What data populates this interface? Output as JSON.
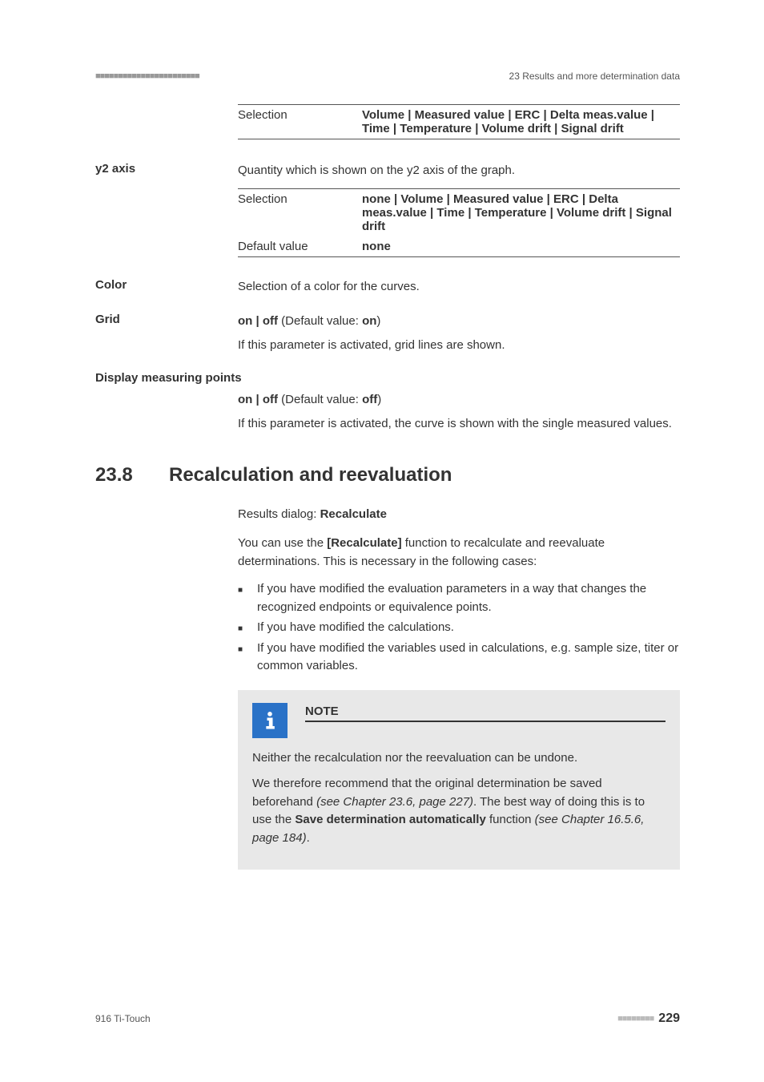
{
  "header": {
    "dots_left": "■■■■■■■■■■■■■■■■■■■■■■■",
    "chapter": "23 Results and more determination data"
  },
  "selection_top": {
    "label": "Selection",
    "value": "Volume | Measured value | ERC | Delta meas.value | Time | Temperature | Volume drift | Signal drift"
  },
  "y2axis": {
    "heading": "y2 axis",
    "desc": "Quantity which is shown on the y2 axis of the graph.",
    "selection_label": "Selection",
    "selection_value": "none | Volume | Measured value | ERC | Delta meas.value | Time | Temperature | Volume drift | Signal drift",
    "default_label": "Default value",
    "default_value": "none"
  },
  "color": {
    "heading": "Color",
    "desc": "Selection of a color for the curves."
  },
  "grid": {
    "heading": "Grid",
    "options_prefix": "on | off",
    "options_default": " (Default value: ",
    "options_default_val": "on",
    "options_close": ")",
    "desc": "If this parameter is activated, grid lines are shown."
  },
  "dmp": {
    "heading": "Display measuring points",
    "options_prefix": "on | off",
    "options_default": " (Default value: ",
    "options_default_val": "off",
    "options_close": ")",
    "desc": "If this parameter is activated, the curve is shown with the single measured values."
  },
  "section": {
    "num": "23.8",
    "title": "Recalculation and reevaluation",
    "dialog_prefix": "Results dialog: ",
    "dialog_bold": "Recalculate",
    "intro_p1": "You can use the ",
    "intro_bold": "[Recalculate]",
    "intro_p2": " function to recalculate and reevaluate determinations. This is necessary in the following cases:",
    "bullets": [
      "If you have modified the evaluation parameters in a way that changes the recognized endpoints or equivalence points.",
      "If you have modified the calculations.",
      "If you have modified the variables used in calculations, e.g. sample size, titer or common variables."
    ]
  },
  "note": {
    "label": "NOTE",
    "text1": "Neither the recalculation nor the reevaluation can be undone.",
    "text2a": "We therefore recommend that the original determination be saved beforehand ",
    "text2b": "(see Chapter 23.6, page 227)",
    "text2c": ". The best way of doing this is to use the ",
    "text2d": "Save determination automatically",
    "text2e": " function ",
    "text2f": "(see Chapter 16.5.6, page 184)",
    "text2g": "."
  },
  "footer": {
    "left": "916 Ti-Touch",
    "dots": "■■■■■■■■",
    "page": "229"
  }
}
